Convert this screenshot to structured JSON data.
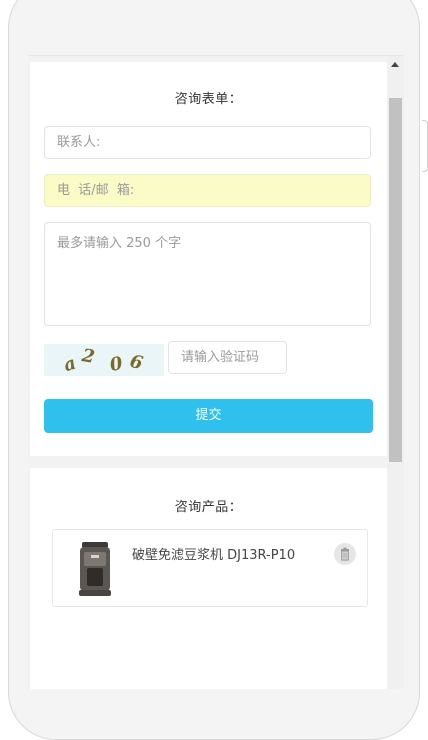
{
  "form": {
    "title": "咨询表单：",
    "contact_placeholder": "联系人:",
    "phone_email_placeholder": "电  话/邮  箱:",
    "message_placeholder": "最多请输入 250 个字",
    "captcha_text": "a2 06",
    "verify_placeholder": "请输入验证码",
    "submit_label": "提交"
  },
  "product": {
    "title": "咨询产品：",
    "items": [
      {
        "name": "破壁免滤豆浆机 DJ13R-P10",
        "image_icon": "soymilk-maker-product-image",
        "remove_icon": "trash-icon"
      }
    ]
  },
  "colors": {
    "submit_bg": "#2fc0ee",
    "highlight_field_bg": "#fafbc6"
  }
}
